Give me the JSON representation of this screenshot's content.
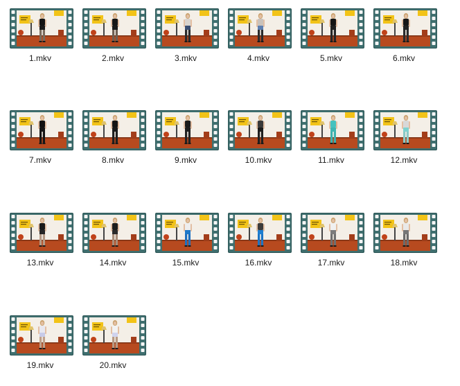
{
  "view": "large-icons",
  "file_icon": "video-film-strip-icon",
  "files": [
    {
      "name": "1.mkv",
      "outfit": {
        "top": "#141414",
        "bottom": "#1b1b1b",
        "legs": "#7a6a5c"
      }
    },
    {
      "name": "2.mkv",
      "outfit": {
        "top": "#161616",
        "bottom": "#1a1a1a",
        "legs": "#6e5f52"
      }
    },
    {
      "name": "3.mkv",
      "outfit": {
        "top": "#d9d4cf",
        "bottom": "#3b4f73",
        "legs": "#2a2a2a"
      }
    },
    {
      "name": "4.mkv",
      "outfit": {
        "top": "#c9c2bb",
        "bottom": "#5d7fb0",
        "legs": "#2b2b2b"
      }
    },
    {
      "name": "5.mkv",
      "outfit": {
        "top": "#151515",
        "bottom": "#202020",
        "legs": "#262626"
      }
    },
    {
      "name": "6.mkv",
      "outfit": {
        "top": "#171717",
        "bottom": "#222222",
        "legs": "#2a2a2a"
      }
    },
    {
      "name": "7.mkv",
      "outfit": {
        "top": "#121212",
        "bottom": "#161616",
        "legs": "#161616"
      }
    },
    {
      "name": "8.mkv",
      "outfit": {
        "top": "#141414",
        "bottom": "#1a1a1a",
        "legs": "#1f1f1f"
      }
    },
    {
      "name": "9.mkv",
      "outfit": {
        "top": "#1b1b1b",
        "bottom": "#1e1e1e",
        "legs": "#232323"
      }
    },
    {
      "name": "10.mkv",
      "outfit": {
        "top": "#3a3a3a",
        "bottom": "#1c1c1c",
        "legs": "#202020"
      }
    },
    {
      "name": "11.mkv",
      "outfit": {
        "top": "#45c2bf",
        "bottom": "#3fb6b3",
        "legs": "#3bb1ae"
      }
    },
    {
      "name": "12.mkv",
      "outfit": {
        "top": "#d8d8d8",
        "bottom": "#7fd2cf",
        "legs": "#8ac9c6"
      }
    },
    {
      "name": "13.mkv",
      "outfit": {
        "top": "#1a1a1a",
        "bottom": "#262626",
        "legs": "#b59a86"
      }
    },
    {
      "name": "14.mkv",
      "outfit": {
        "top": "#1c1c1c",
        "bottom": "#2a2a2a",
        "legs": "#a88d79"
      }
    },
    {
      "name": "15.mkv",
      "outfit": {
        "top": "#eeeeee",
        "bottom": "#1e78c8",
        "legs": "#1d6fbf"
      }
    },
    {
      "name": "16.mkv",
      "outfit": {
        "top": "#3b3b3b",
        "bottom": "#1f7fd1",
        "legs": "#1c74c4"
      }
    },
    {
      "name": "17.mkv",
      "outfit": {
        "top": "#f0f0f0",
        "bottom": "#7c7c7c",
        "legs": "#6f6f6f"
      }
    },
    {
      "name": "18.mkv",
      "outfit": {
        "top": "#e9e9e9",
        "bottom": "#777777",
        "legs": "#6b6b6b"
      }
    },
    {
      "name": "19.mkv",
      "outfit": {
        "top": "#e8e8f0",
        "bottom": "#c8cbe8",
        "legs": "#c0a08a"
      }
    },
    {
      "name": "20.mkv",
      "outfit": {
        "top": "#f2f2f2",
        "bottom": "#d0d3ee",
        "legs": "#b89a84"
      }
    }
  ],
  "colors": {
    "film_frame": "#3f6f6f",
    "film_frame_dark": "#2c5656",
    "sprocket_hole": "#f5f5f5",
    "wall": "#f4efe7",
    "poster": "#f2c318",
    "floor": "#b74a1f",
    "lamp": "#e0c36b",
    "skin": "#e3bfa3",
    "hair": "#c9a06b",
    "label_text": "#1b1b1b"
  }
}
